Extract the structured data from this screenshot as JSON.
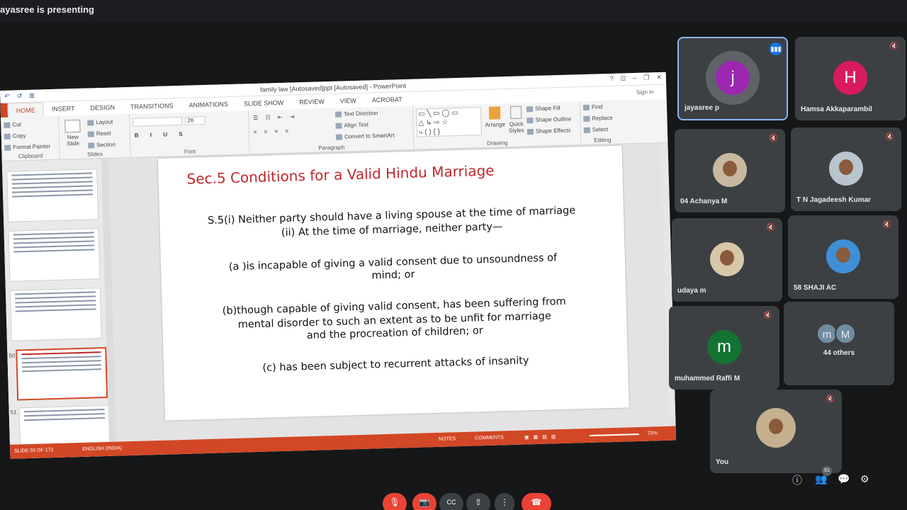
{
  "meeting": {
    "presenting_text": "ayasree is presenting"
  },
  "ppt": {
    "doc_title": "family law [Autosaved]ppt [Autosaved] - PowerPoint",
    "quick_access": [
      "↶",
      "↺",
      "⊞"
    ],
    "window_buttons": [
      "?",
      "⊡",
      "–",
      "❐",
      "✕"
    ],
    "tabs": [
      "HOME",
      "INSERT",
      "DESIGN",
      "TRANSITIONS",
      "ANIMATIONS",
      "SLIDE SHOW",
      "REVIEW",
      "VIEW",
      "ACROBAT"
    ],
    "sign_in": "Sign in",
    "ribbon": {
      "cut": "Cut",
      "copy": "Copy",
      "format_painter": "Format Painter",
      "clipboard": "Clipboard",
      "new_slide": "New Slide",
      "layout": "Layout",
      "reset": "Reset",
      "section": "Section",
      "slides": "Slides",
      "font_size": "28",
      "font": "Font",
      "paragraph": "Paragraph",
      "text_direction": "Text Direction",
      "align_text": "Align Text",
      "convert_smartart": "Convert to SmartArt",
      "arrange": "Arrange",
      "quick_styles": "Quick Styles",
      "shape_fill": "Shape Fill",
      "shape_outline": "Shape Outline",
      "shape_effects": "Shape Effects",
      "drawing": "Drawing",
      "find": "Find",
      "replace": "Replace",
      "select": "Select",
      "editing": "Editing"
    },
    "thumb_numbers": [
      "50",
      "51"
    ],
    "slide": {
      "title": "Sec.5 Conditions for a Valid Hindu Marriage",
      "lines": [
        "S.5(i) Neither party should have a living spouse at the time of marriage",
        "(ii) At the time of marriage, neither party—",
        "(a )is incapable of giving a valid consent due to unsoundness of",
        "mind; or",
        "(b)though capable of giving valid consent, has been suffering from",
        "mental disorder to such an extent as to be unfit for marriage",
        "and the procreation of children; or",
        "(c) has been subject to recurrent attacks of insanity"
      ]
    },
    "status": {
      "slide_count": "SLIDE 50 OF 172",
      "language": "ENGLISH (INDIA)",
      "notes": "NOTES",
      "comments": "COMMENTS",
      "zoom": "73%"
    }
  },
  "participants": [
    {
      "name": "jayasree p",
      "initial": "j",
      "color": "#9c27b0"
    },
    {
      "name": "Hamsa Akkaparambil",
      "initial": "H",
      "color": "#d81b60"
    },
    {
      "name": "04 Achanya M"
    },
    {
      "name": "T N Jagadeesh Kumar"
    },
    {
      "name": "udaya m"
    },
    {
      "name": "58 SHAJI AC"
    },
    {
      "name": "muhammed Raffi M",
      "initial": "m",
      "color": "#137333"
    },
    {
      "name": "44 others",
      "initials": [
        "m",
        "M"
      ]
    },
    {
      "name": "You"
    }
  ],
  "controls": {
    "mic": "🎙",
    "camera": "📷",
    "captions": "CC",
    "present": "⇧",
    "more": "⋮",
    "end_call": "☎",
    "info": "ⓘ",
    "people": "👥",
    "people_count": "51",
    "chat": "💬",
    "activities": "⚙"
  },
  "colors": {
    "accent": "#1a73e8",
    "ppt_orange": "#d24726",
    "slide_title": "#c0272d",
    "end_call": "#ea4335"
  }
}
